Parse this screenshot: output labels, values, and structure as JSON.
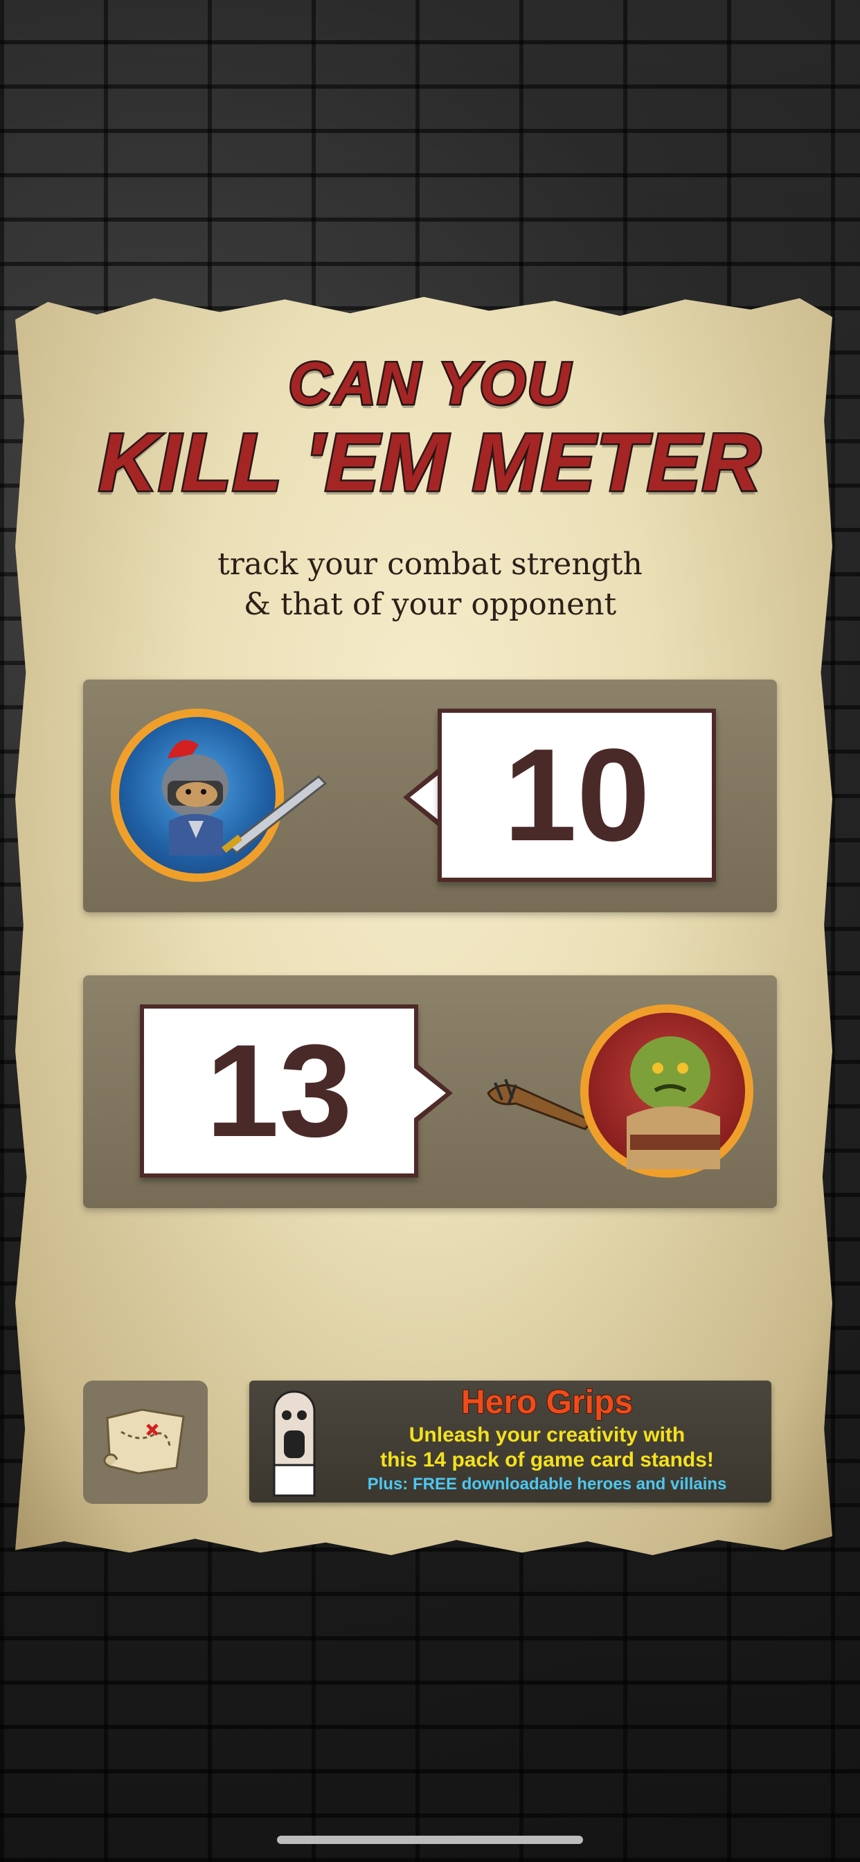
{
  "title": {
    "line1": "CAN YOU",
    "line2": "KILL 'EM METER"
  },
  "subtitle": {
    "line1": "track your combat strength",
    "line2": "& that of your opponent"
  },
  "hero": {
    "value": "10"
  },
  "villain": {
    "value": "13"
  },
  "banner": {
    "title": "Hero Grips",
    "line1": "Unleash your creativity with",
    "line2": "this 14 pack of game card stands!",
    "line3": "Plus: FREE downloadable heroes and villains"
  },
  "colors": {
    "accent_red": "#a52525",
    "value_text": "#4a2a28",
    "banner_title": "#f24a1a",
    "banner_yellow": "#f5e11c",
    "banner_cyan": "#4cc8f0"
  },
  "icons": [
    "knight-hero-icon",
    "sword-icon",
    "orc-villain-icon",
    "spiked-club-icon",
    "treasure-map-icon",
    "hero-grips-figure-icon"
  ]
}
